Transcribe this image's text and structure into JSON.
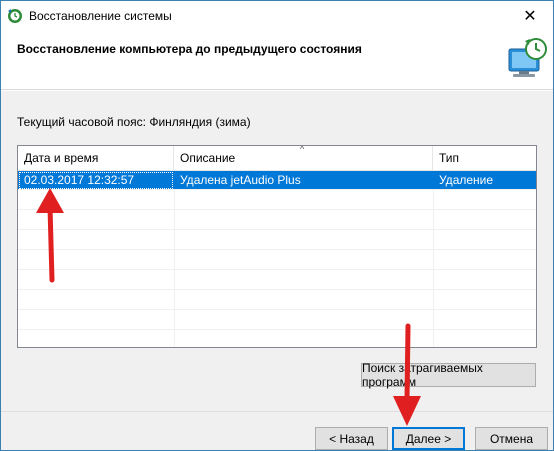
{
  "window": {
    "title": "Восстановление системы",
    "close_glyph": "✕"
  },
  "header": {
    "title": "Восстановление компьютера до предыдущего состояния"
  },
  "content": {
    "timezone_label": "Текущий часовой пояс: Финляндия (зима)"
  },
  "table": {
    "columns": [
      "Дата и время",
      "Описание",
      "Тип"
    ],
    "rows": [
      {
        "date": "02.03.2017 12:32:57",
        "description": "Удалена jetAudio Plus",
        "type": "Удаление"
      }
    ],
    "sort_glyph": "^"
  },
  "buttons": {
    "scan_programs": "Поиск затрагиваемых программ",
    "back": "< Назад",
    "next": "Далее >",
    "cancel": "Отмена"
  },
  "colors": {
    "selection": "#0078d7",
    "annotation_arrow": "#e02020"
  }
}
